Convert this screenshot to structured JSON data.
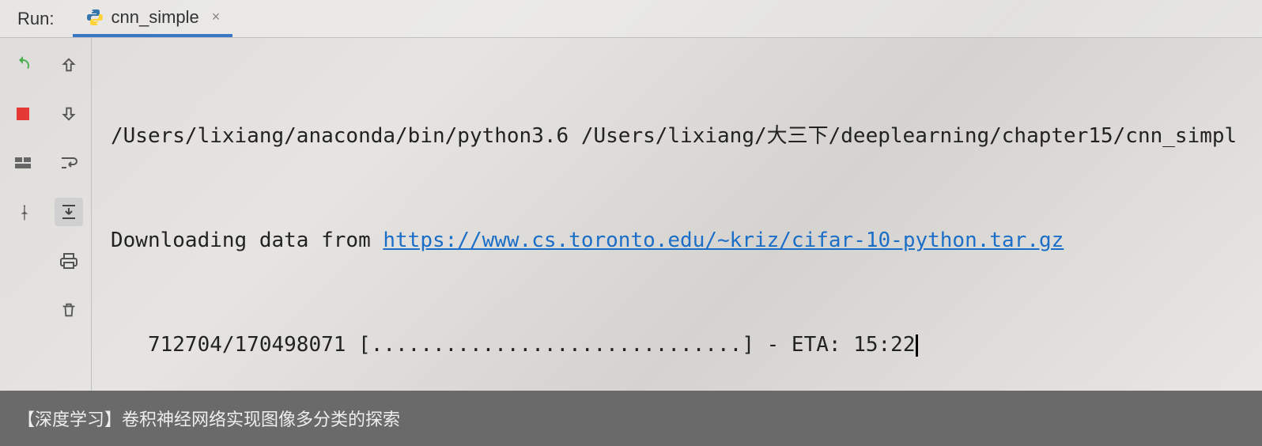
{
  "header": {
    "run_label": "Run:",
    "tab": {
      "label": "cnn_simple",
      "icon": "python-icon"
    }
  },
  "toolbars": {
    "left": [
      {
        "name": "rerun-icon",
        "color": "#4caf50"
      },
      {
        "name": "stop-icon",
        "color": "#e53935"
      },
      {
        "name": "layout-icon",
        "color": "#666"
      },
      {
        "name": "pin-icon",
        "color": "#666"
      }
    ],
    "second": [
      {
        "name": "up-arrow-icon",
        "color": "#555"
      },
      {
        "name": "down-arrow-icon",
        "color": "#555"
      },
      {
        "name": "soft-wrap-icon",
        "color": "#555"
      },
      {
        "name": "scroll-to-end-icon",
        "color": "#555",
        "active": true
      },
      {
        "name": "print-icon",
        "color": "#555"
      },
      {
        "name": "trash-icon",
        "color": "#555"
      }
    ]
  },
  "console": {
    "line1": "/Users/lixiang/anaconda/bin/python3.6 /Users/lixiang/大三下/deeplearning/chapter15/cnn_simpl",
    "line2_prefix": "Downloading data from ",
    "line2_link": "https://www.cs.toronto.edu/~kriz/cifar-10-python.tar.gz",
    "line3": "   712704/170498071 [..............................] - ETA: 15:22"
  },
  "footer": {
    "text": "【深度学习】卷积神经网络实现图像多分类的探索"
  }
}
